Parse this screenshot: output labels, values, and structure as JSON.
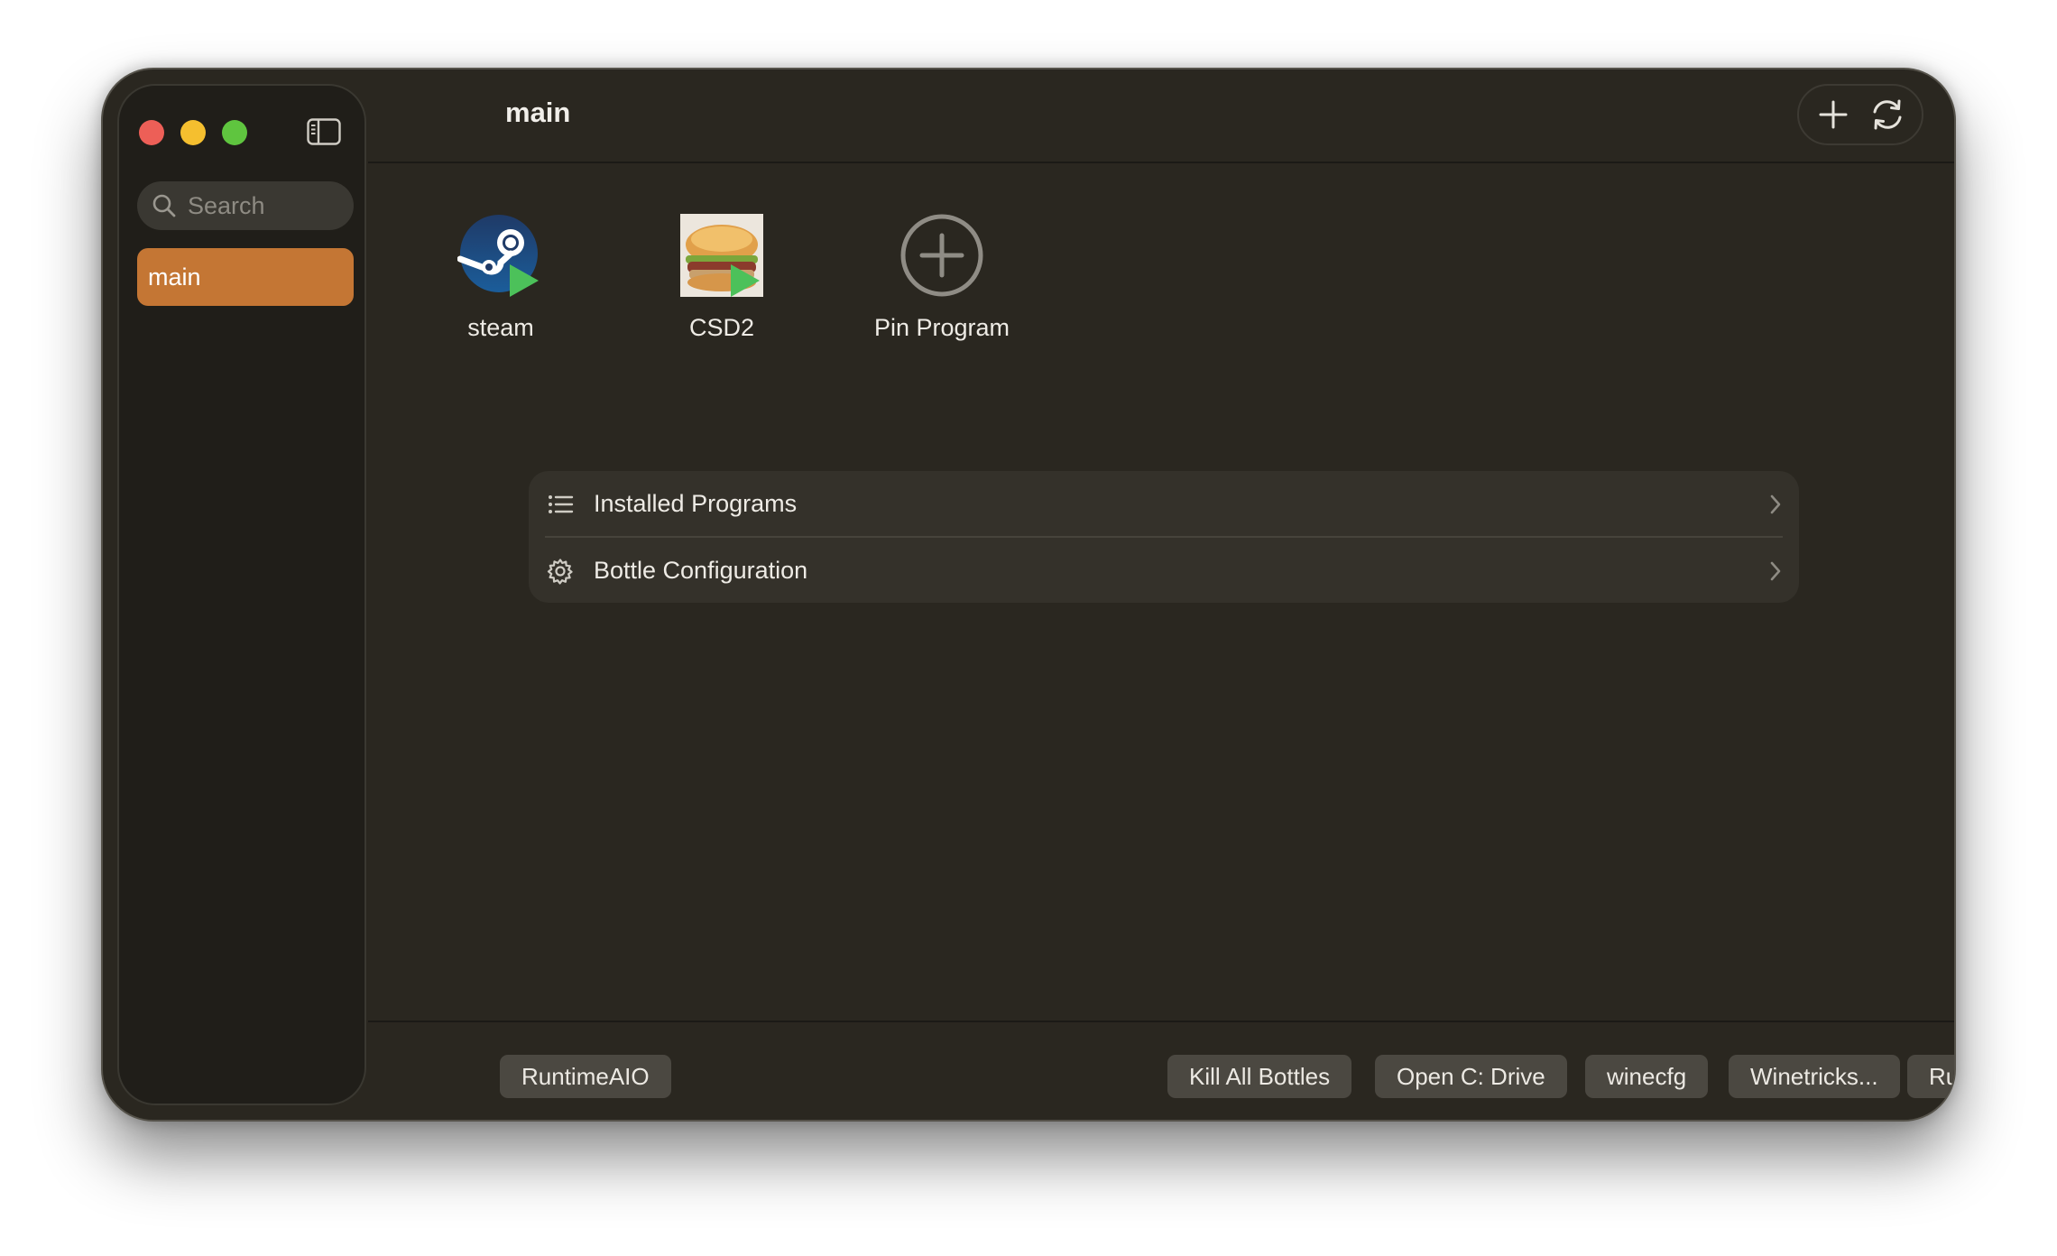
{
  "window": {
    "title": "main"
  },
  "sidebar": {
    "search_placeholder": "Search",
    "bottles": [
      {
        "label": "main",
        "selected": true
      }
    ]
  },
  "toolbar": {
    "add_icon": "plus-icon",
    "refresh_icon": "refresh-icon"
  },
  "pinned": [
    {
      "label": "steam",
      "icon": "steam-app-icon"
    },
    {
      "label": "CSD2",
      "icon": "csd2-app-icon"
    },
    {
      "label": "Pin Program",
      "icon": "plus-circle-icon"
    }
  ],
  "sections": [
    {
      "label": "Installed Programs",
      "icon": "list-icon"
    },
    {
      "label": "Bottle Configuration",
      "icon": "gear-icon"
    }
  ],
  "footer": {
    "runtime_label": "RuntimeAIO",
    "kill_all_label": "Kill All Bottles",
    "open_c_label": "Open C: Drive",
    "winecfg_label": "winecfg",
    "winetricks_label": "Winetricks...",
    "run_label": "Run..."
  },
  "colors": {
    "accent": "#c47634",
    "window_bg": "#2a2720",
    "sidebar_bg": "#201e19"
  }
}
